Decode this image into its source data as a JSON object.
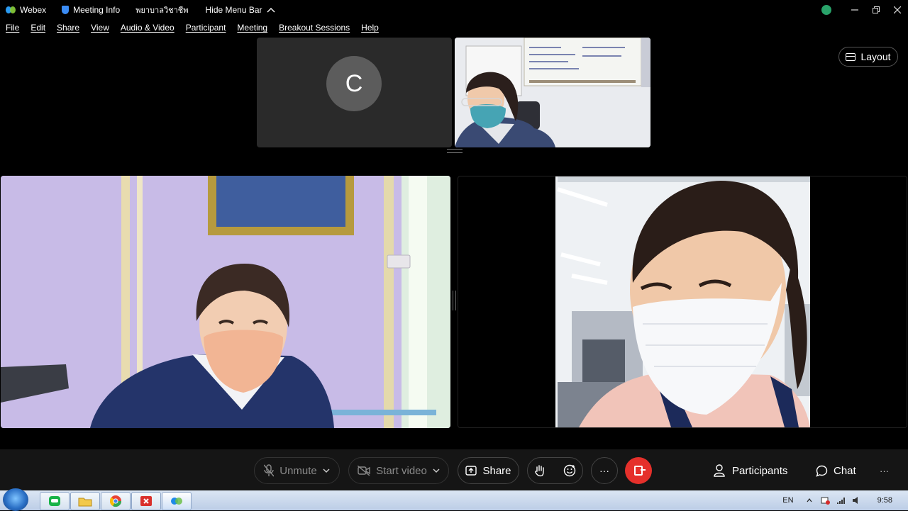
{
  "titlebar": {
    "app_name": "Webex",
    "meeting_info": "Meeting Info",
    "meeting_title": "พยาบาลวิชาชีพ",
    "hide_menu_bar": "Hide Menu Bar"
  },
  "menu": [
    "File",
    "Edit",
    "Share",
    "View",
    "Audio & Video",
    "Participant",
    "Meeting",
    "Breakout Sessions",
    "Help"
  ],
  "layout_button": "Layout",
  "participants": {
    "avatar_initial": "C"
  },
  "controls": {
    "unmute": "Unmute",
    "start_video": "Start video",
    "share": "Share",
    "more": "···",
    "participants": "Participants",
    "chat": "Chat",
    "overflow": "···"
  },
  "taskbar": {
    "language": "EN",
    "time": "9:58"
  },
  "colors": {
    "background": "#000000",
    "control_bar": "#151515",
    "leave_red": "#e5302b",
    "avatar_gray": "#5c5c5c",
    "status_green": "#29a36a"
  }
}
